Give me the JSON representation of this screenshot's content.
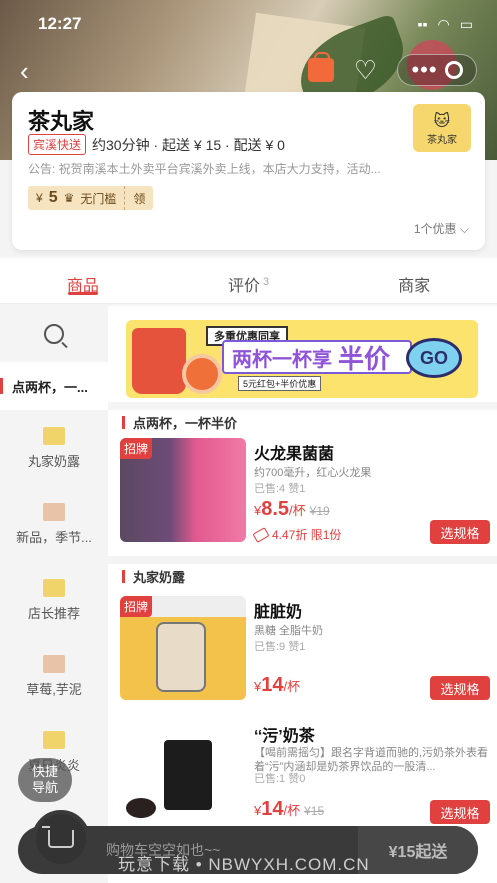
{
  "status": {
    "time": "12:27",
    "signal": "…",
    "wifi": "wifi",
    "battery": "battery"
  },
  "nav": {
    "back": "‹",
    "icons": [
      "bag-icon",
      "heart-icon",
      "more-icon",
      "circle-icon"
    ]
  },
  "shop": {
    "name": "茶丸家",
    "logo_text": "茶丸家",
    "delivery_tag": "宾溪快送",
    "delivery_info": "约30分钟 · 起送 ¥ 15 · 配送 ¥ 0",
    "notice": "公告: 祝贺南溪本土外卖平台宾溪外卖上线，本店大力支持，活动...",
    "coupon": {
      "currency": "¥",
      "amount": "5",
      "label": "无门槛",
      "get": "领"
    },
    "promo_count": "1个优惠"
  },
  "tabs": [
    {
      "label": "商品"
    },
    {
      "label": "评价",
      "count": "3"
    },
    {
      "label": "商家"
    }
  ],
  "sidebar": {
    "active": "点两杯，一...",
    "items": [
      "丸家奶露",
      "新品，季节...",
      "店长推荐",
      "草莓,芋泥",
      "夏日炎炎"
    ]
  },
  "banner": {
    "top": "多重优惠同享",
    "title": "两杯一杯享",
    "big": "半价",
    "sub": "5元红包+半价优惠",
    "go": "GO"
  },
  "sections": [
    {
      "title": "点两杯，一杯半价",
      "items": [
        {
          "badge": "招牌",
          "name": "火龙果菌菌",
          "desc": "约700毫升，红心火龙果",
          "sales": "已售:4 赞1",
          "currency": "¥",
          "price": "8.5",
          "unit": "/杯",
          "orig": "¥19",
          "discount": "4.47折 限1份",
          "button": "选规格"
        }
      ]
    },
    {
      "title": "丸家奶露",
      "items": [
        {
          "badge": "招牌",
          "name": "脏脏奶",
          "desc": "黑糖 全脂牛奶",
          "sales": "已售:9 赞1",
          "currency": "¥",
          "price": "14",
          "unit": "/杯",
          "orig": "",
          "button": "选规格"
        },
        {
          "badge": "",
          "name": "‘‘污’奶茶",
          "desc": "【喝前需摇匀】跟名字背道而驰的,污奶茶外表看着“污”内涵却是奶茶界饮品的一股清...",
          "sales": "已售:1 赞0",
          "currency": "¥",
          "price": "14",
          "unit": "/杯",
          "orig": "¥15",
          "button": "选规格"
        }
      ]
    }
  ],
  "quick_nav": "快捷导航",
  "cart": {
    "empty_text": "购物车空空如也~~",
    "min_order": "¥15起送"
  },
  "watermark": "玩意下载 • NBWYXH.COM.CN"
}
